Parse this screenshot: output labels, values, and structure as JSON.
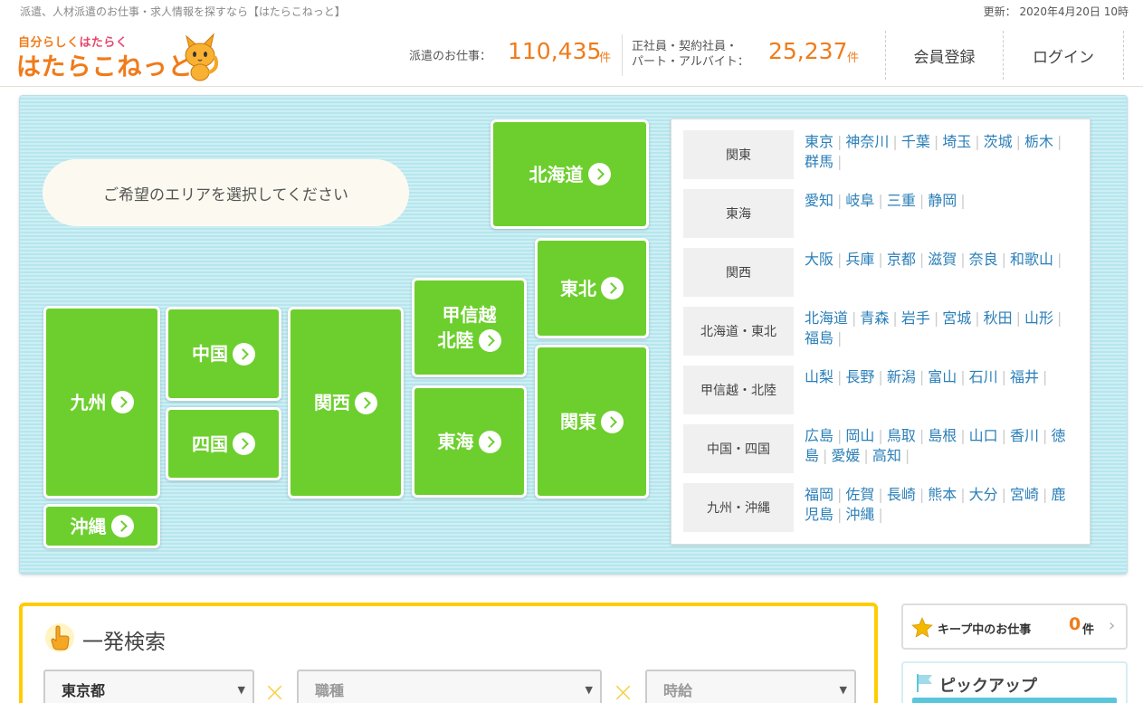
{
  "topbar": {
    "tagline": "派遣、人材派遣のお仕事・求人情報を探すなら【はたらこねっと】",
    "updated": "更新： 2020年4月20日 10時"
  },
  "logo": {
    "tagline_orange": "自分らしく",
    "tagline_pink": "はたらく",
    "name": "はたらこねっと"
  },
  "stats": {
    "haken_label": "派遣のお仕事：",
    "haken_count": "110,435",
    "haken_unit": "件",
    "seishain_label_line1": "正社員・契約社員・",
    "seishain_label_line2": "パート・アルバイト：",
    "seishain_count": "25,237",
    "seishain_unit": "件"
  },
  "header_nav": {
    "register": "会員登録",
    "login": "ログイン"
  },
  "area": {
    "prompt": "ご希望のエリアを選択してください",
    "regions": {
      "hokkaido": "北海道",
      "tohoku": "東北",
      "koshinetsu_line1": "甲信越",
      "koshinetsu_line2": "北陸",
      "kanto": "関東",
      "tokai": "東海",
      "kansai": "関西",
      "chugoku": "中国",
      "shikoku": "四国",
      "kyushu": "九州",
      "okinawa": "沖縄"
    },
    "pref_table": [
      {
        "region": "関東",
        "prefs": [
          "東京",
          "神奈川",
          "千葉",
          "埼玉",
          "茨城",
          "栃木",
          "群馬"
        ]
      },
      {
        "region": "東海",
        "prefs": [
          "愛知",
          "岐阜",
          "三重",
          "静岡"
        ]
      },
      {
        "region": "関西",
        "prefs": [
          "大阪",
          "兵庫",
          "京都",
          "滋賀",
          "奈良",
          "和歌山"
        ]
      },
      {
        "region": "北海道・東北",
        "prefs": [
          "北海道",
          "青森",
          "岩手",
          "宮城",
          "秋田",
          "山形",
          "福島"
        ]
      },
      {
        "region": "甲信越・北陸",
        "prefs": [
          "山梨",
          "長野",
          "新潟",
          "富山",
          "石川",
          "福井"
        ]
      },
      {
        "region": "中国・四国",
        "prefs": [
          "広島",
          "岡山",
          "鳥取",
          "島根",
          "山口",
          "香川",
          "徳島",
          "愛媛",
          "高知"
        ]
      },
      {
        "region": "九州・沖縄",
        "prefs": [
          "福岡",
          "佐賀",
          "長崎",
          "熊本",
          "大分",
          "宮崎",
          "鹿児島",
          "沖縄"
        ]
      }
    ]
  },
  "search": {
    "title": "一発検索",
    "pref_value": "東京都",
    "job_placeholder": "職種",
    "wage_placeholder": "時給",
    "separator": "×"
  },
  "keep": {
    "label": "キープ中のお仕事",
    "count": "0",
    "unit": "件"
  },
  "pickup": {
    "label": "ピックアップ"
  },
  "colors": {
    "brand_orange": "#f07b1a",
    "region_green": "#6ccf2d",
    "link_blue": "#2b7fb8",
    "search_yellow": "#ffcc00"
  }
}
